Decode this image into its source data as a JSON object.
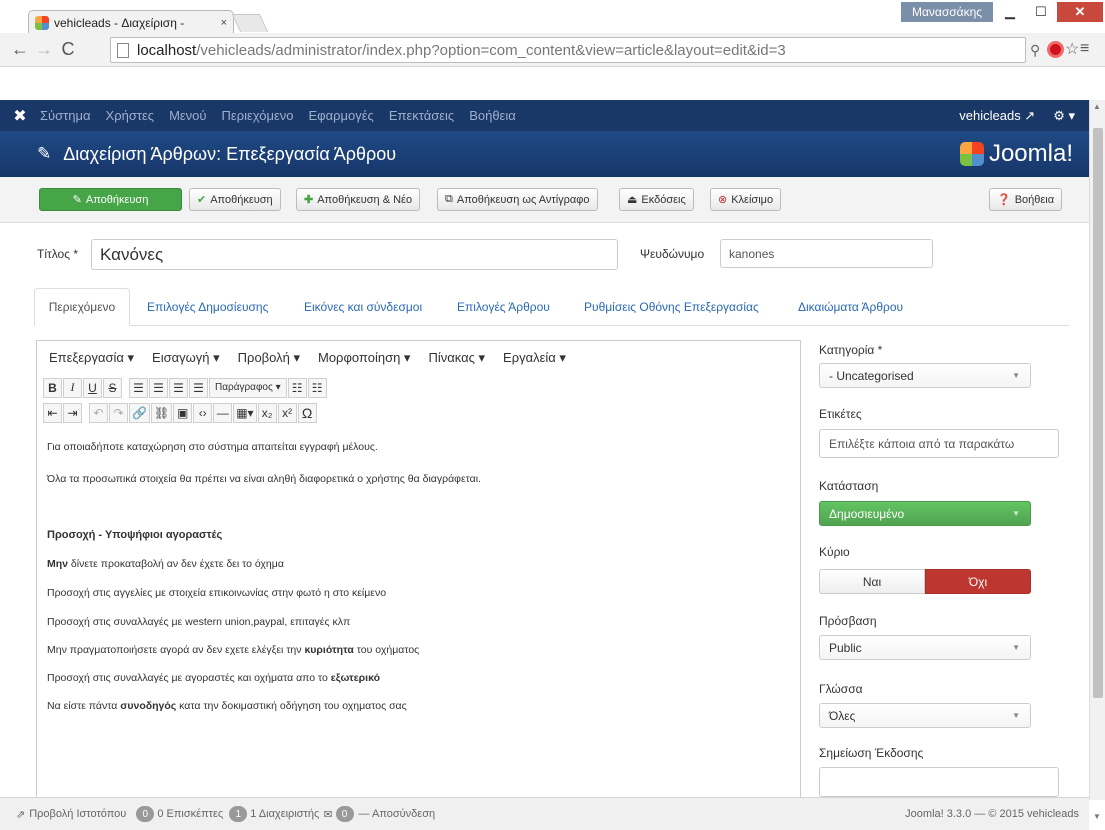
{
  "browser": {
    "tab_title": "vehicleads - Διαχείριση - ",
    "tab_close": "×",
    "user_badge": "Μανασσάκης",
    "url_host": "localhost",
    "url_path": "/vehicleads/administrator/index.php?option=com_content&view=article&layout=edit&id=3"
  },
  "topmenu": {
    "items": [
      "Σύστημα",
      "Χρήστες",
      "Μενού",
      "Περιεχόμενο",
      "Εφαρμογές",
      "Επεκτάσεις",
      "Βοήθεια"
    ],
    "site_link": "vehicleads ↗",
    "settings": "⚙ ▾"
  },
  "header": {
    "title": "Διαχείριση Άρθρων: Επεξεργασία Άρθρου",
    "logo_text": "Joomla!"
  },
  "toolbar": {
    "apply": "Αποθήκευση",
    "save_close": "Αποθήκευση",
    "save_new": "Αποθήκευση & Νέο",
    "save_copy": "Αποθήκευση ως Αντίγραφο",
    "versions": "Εκδόσεις",
    "close": "Κλείσιμο",
    "help": "Βοήθεια"
  },
  "form": {
    "title_label": "Τίτλος *",
    "title_value": "Κανόνες",
    "alias_label": "Ψευδώνυμο",
    "alias_value": "kanones"
  },
  "tabs": [
    "Περιεχόμενο",
    "Επιλογές Δημοσίευσης",
    "Εικόνες και σύνδεσμοι",
    "Επιλογές Άρθρου",
    "Ρυθμίσεις Οθόνης Επεξεργασίας",
    "Δικαιώματα Άρθρου"
  ],
  "editor": {
    "menu": [
      "Επεξεργασία ▾",
      "Εισαγωγή ▾",
      "Προβολή ▾",
      "Μορφοποίηση ▾",
      "Πίνακας ▾",
      "Εργαλεία ▾"
    ],
    "format_select": "Παράγραφος",
    "content": {
      "p1": "Για οποιαδήποτε καταχώρηση στο σύστημα απαιτείται εγγραφή μέλους.",
      "p2": "Όλα τα προσωπικά στοιχεία θα πρέπει να είναι αληθή διαφορετικά ο χρήστης θα διαγράφεται.",
      "h": "Προσοχή - Υποψήφιοι αγοραστές",
      "p3_bold": "Μην",
      "p3_rest": " δίνετε προκαταβολή αν δεν έχετε δει το όχημα",
      "p4": "Προσοχή στις αγγελίες με στοιχεία επικοινωνίας στην φωτό η στο κείμενο",
      "p5": "Προσοχή στις συναλλαγές με western union,paypal, επιταγές κλπ",
      "p6_a": "Μην πραγματοποιήσετε αγορά αν δεν εχετε ελέγξει την ",
      "p6_b": "κυριότητα",
      "p6_c": " του οχήματος",
      "p7_a": "Προσοχή στις συναλλαγές με αγοραστές και οχήματα απο το ",
      "p7_b": "εξωτερικό",
      "p8_a": "Να είστε πάντα ",
      "p8_b": "συνοδηγός",
      "p8_c": " κατα την δοκιμαστική οδήγηση του οχηματος σας"
    }
  },
  "sidebar": {
    "category_label": "Κατηγορία *",
    "category_value": "- Uncategorised",
    "tags_label": "Ετικέτες",
    "tags_placeholder": "Επιλέξτε κάποια από τα παρακάτω",
    "status_label": "Κατάσταση",
    "status_value": "Δημοσιευμένο",
    "featured_label": "Κύριο",
    "featured_yes": "Ναι",
    "featured_no": "Όχι",
    "access_label": "Πρόσβαση",
    "access_value": "Public",
    "language_label": "Γλώσσα",
    "language_value": "Όλες",
    "version_note_label": "Σημείωση Έκδοσης"
  },
  "statusbar": {
    "view_site": "Προβολή Ιστοτόπου",
    "visitors_count": "0",
    "visitors_text": "0 Επισκέπτες",
    "admins_count": "1",
    "admins_text": "1 Διαχειριστής",
    "messages_count": "0",
    "logout": "— Αποσύνδεση",
    "version": "Joomla! 3.3.0 — © 2015 vehicleads"
  },
  "colors": {
    "topmenu_bg": "#1a3867",
    "header_bg": "#1f4a84",
    "apply_green": "#46a546",
    "status_green": "#5bb75b",
    "no_red": "#bd362f",
    "link_blue": "#2a69b8"
  }
}
